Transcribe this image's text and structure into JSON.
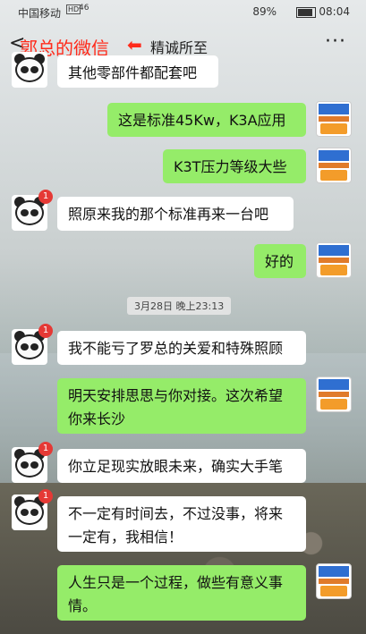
{
  "status_bar": {
    "carrier": "中国移动",
    "hd": "HD",
    "signal": "46",
    "battery": "89%",
    "time": "08:04"
  },
  "nav": {
    "back_glyph": "<",
    "annotation": "郭总的微信",
    "arrow_glyph": "⬅",
    "title": "精诚所至",
    "more_glyph": "···"
  },
  "messages": [
    {
      "side": "left",
      "text": "其他零部件都配套吧",
      "badge": ""
    },
    {
      "side": "right",
      "text": "这是标准45Kw，K3A应用"
    },
    {
      "side": "right",
      "text": "K3T压力等级大些"
    },
    {
      "side": "left",
      "text": "照原来我的那个标准再来一台吧",
      "badge": "1"
    },
    {
      "side": "right",
      "text": "好的"
    },
    {
      "side": "left",
      "text": "我不能亏了罗总的关爱和特殊照顾",
      "badge": "1"
    },
    {
      "side": "right",
      "text": "明天安排思思与你对接。这次希望你来长沙"
    },
    {
      "side": "left",
      "text": "你立足现实放眼未来，确实大手笔",
      "badge": "1"
    },
    {
      "side": "left",
      "text": "不一定有时间去，不过没事，将来一定有，我相信！",
      "badge": "1"
    },
    {
      "side": "right",
      "text": "人生只是一个过程，做些有意义事情。"
    }
  ],
  "timestamp": "3月28日 晚上23:13"
}
